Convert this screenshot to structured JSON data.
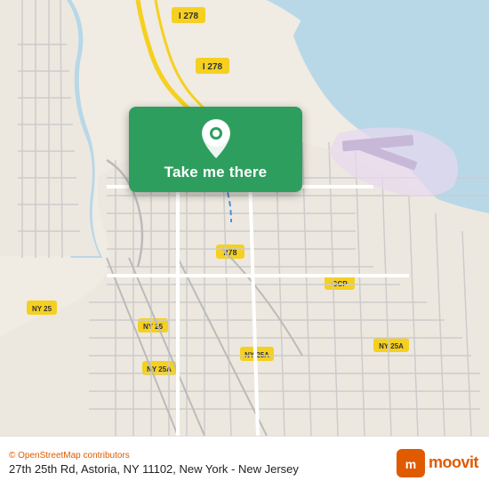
{
  "map": {
    "background_color": "#e8dfd0",
    "attribution": "© OpenStreetMap contributors"
  },
  "card": {
    "button_label": "Take me there",
    "background_color": "#2e9e5e"
  },
  "footer": {
    "attribution_text": "© OpenStreetMap contributors",
    "address": "27th 25th Rd, Astoria, NY 11102, New York - New Jersey",
    "brand_name": "moovit"
  }
}
